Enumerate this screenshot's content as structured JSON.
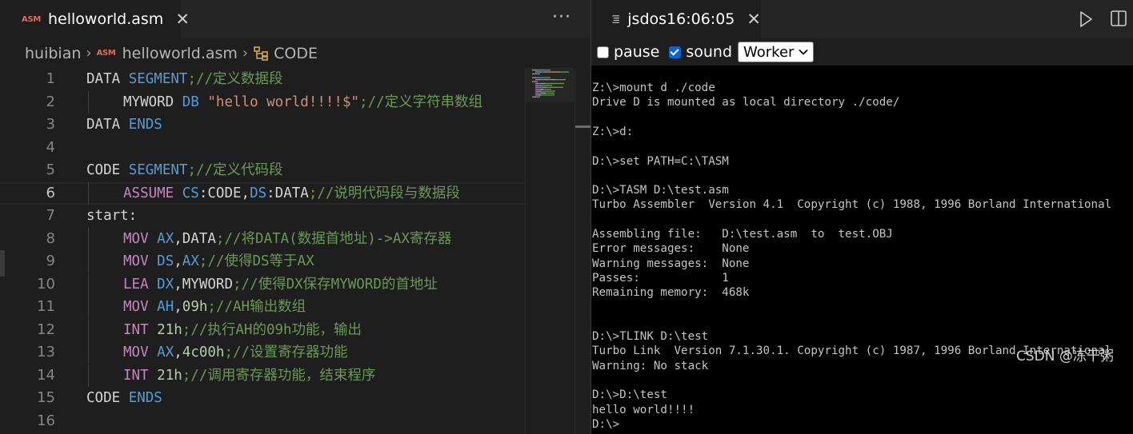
{
  "left_pane": {
    "tab": {
      "badge": "ASM",
      "title": "helloworld.asm",
      "close": "✕"
    },
    "more_actions": "···",
    "breadcrumb": {
      "folder": "huibian",
      "badge": "ASM",
      "file": "helloworld.asm",
      "symbol": "CODE"
    },
    "line_numbers": [
      "1",
      "2",
      "3",
      "4",
      "5",
      "6",
      "7",
      "8",
      "9",
      "10",
      "11",
      "12",
      "13",
      "14",
      "15",
      "16"
    ],
    "active_line": "6",
    "code": [
      [
        {
          "t": "DATA ",
          "c": "id"
        },
        {
          "t": "SEGMENT",
          "c": "kw"
        },
        {
          "t": ";//定义数据段",
          "c": "cm"
        }
      ],
      [
        {
          "t": "MYWORD ",
          "c": "id"
        },
        {
          "t": "DB",
          "c": "kw"
        },
        {
          "t": " ",
          "c": "pl"
        },
        {
          "t": "\"hello world!!!!$\"",
          "c": "str"
        },
        {
          "t": ";//定义字符串数组",
          "c": "cm"
        }
      ],
      [
        {
          "t": "DATA ",
          "c": "id"
        },
        {
          "t": "ENDS",
          "c": "kw"
        }
      ],
      [],
      [
        {
          "t": "CODE ",
          "c": "id"
        },
        {
          "t": "SEGMENT",
          "c": "kw"
        },
        {
          "t": ";//定义代码段",
          "c": "cm"
        }
      ],
      [
        {
          "t": "ASSUME ",
          "c": "op"
        },
        {
          "t": "CS",
          "c": "kw"
        },
        {
          "t": ":CODE,",
          "c": "pl"
        },
        {
          "t": "DS",
          "c": "kw"
        },
        {
          "t": ":DATA",
          "c": "pl"
        },
        {
          "t": ";//说明代码段与数据段",
          "c": "cm"
        }
      ],
      [
        {
          "t": "start:",
          "c": "id"
        }
      ],
      [
        {
          "t": "MOV ",
          "c": "op"
        },
        {
          "t": "AX",
          "c": "kw"
        },
        {
          "t": ",DATA",
          "c": "pl"
        },
        {
          "t": ";//将DATA(数据首地址)->AX寄存器",
          "c": "cm"
        }
      ],
      [
        {
          "t": "MOV ",
          "c": "op"
        },
        {
          "t": "DS",
          "c": "kw"
        },
        {
          "t": ",",
          "c": "pl"
        },
        {
          "t": "AX",
          "c": "kw"
        },
        {
          "t": ";//使得DS等于AX",
          "c": "cm"
        }
      ],
      [
        {
          "t": "LEA ",
          "c": "op"
        },
        {
          "t": "DX",
          "c": "kw"
        },
        {
          "t": ",MYWORD",
          "c": "pl"
        },
        {
          "t": ";//使得DX保存MYWORD的首地址",
          "c": "cm"
        }
      ],
      [
        {
          "t": "MOV ",
          "c": "op"
        },
        {
          "t": "AH",
          "c": "kw"
        },
        {
          "t": ",",
          "c": "pl"
        },
        {
          "t": "09h",
          "c": "num"
        },
        {
          "t": ";//AH输出数组",
          "c": "cm"
        }
      ],
      [
        {
          "t": "INT ",
          "c": "op"
        },
        {
          "t": "21h",
          "c": "num"
        },
        {
          "t": ";//执行AH的09h功能，输出",
          "c": "cm"
        }
      ],
      [
        {
          "t": "MOV ",
          "c": "op"
        },
        {
          "t": "AX",
          "c": "kw"
        },
        {
          "t": ",",
          "c": "pl"
        },
        {
          "t": "4c00h",
          "c": "num"
        },
        {
          "t": ";//设置寄存器功能",
          "c": "cm"
        }
      ],
      [
        {
          "t": "INT ",
          "c": "op"
        },
        {
          "t": "21h",
          "c": "num"
        },
        {
          "t": ";//调用寄存器功能，结束程序",
          "c": "cm"
        }
      ],
      [
        {
          "t": "CODE ",
          "c": "id"
        },
        {
          "t": "ENDS",
          "c": "kw"
        }
      ],
      []
    ],
    "indented_lines": [
      "2",
      "6",
      "8",
      "9",
      "10",
      "11",
      "12",
      "13",
      "14"
    ]
  },
  "right_pane": {
    "tab": {
      "title": "jsdos16:06:05",
      "close": "✕"
    },
    "controls": {
      "pause_label": "pause",
      "pause_checked": false,
      "sound_label": "sound",
      "sound_checked": true,
      "worker_value": "Worker"
    },
    "terminal_lines": [
      "Z:\\>mount d ./code",
      "Drive D is mounted as local directory ./code/",
      "",
      "Z:\\>d:",
      "",
      "D:\\>set PATH=C:\\TASM",
      "",
      "D:\\>TASM D:\\test.asm",
      "Turbo Assembler  Version 4.1  Copyright (c) 1988, 1996 Borland International",
      "",
      "Assembling file:   D:\\test.asm  to  test.OBJ",
      "Error messages:    None",
      "Warning messages:  None",
      "Passes:            1",
      "Remaining memory:  468k",
      "",
      "",
      "D:\\>TLINK D:\\test",
      "Turbo Link  Version 7.1.30.1. Copyright (c) 1987, 1996 Borland International",
      "Warning: No stack",
      "",
      "D:\\>D:\\test",
      "hello world!!!!",
      "D:\\>"
    ],
    "watermark": "CSDN @冻干粥"
  },
  "colors": {
    "keyword_blue": "#569cd6",
    "instruction_pink": "#c586c0",
    "string_orange": "#ce9178",
    "number_green": "#b5cea8",
    "comment_green": "#6a9955",
    "badge_red": "#e06c58"
  }
}
